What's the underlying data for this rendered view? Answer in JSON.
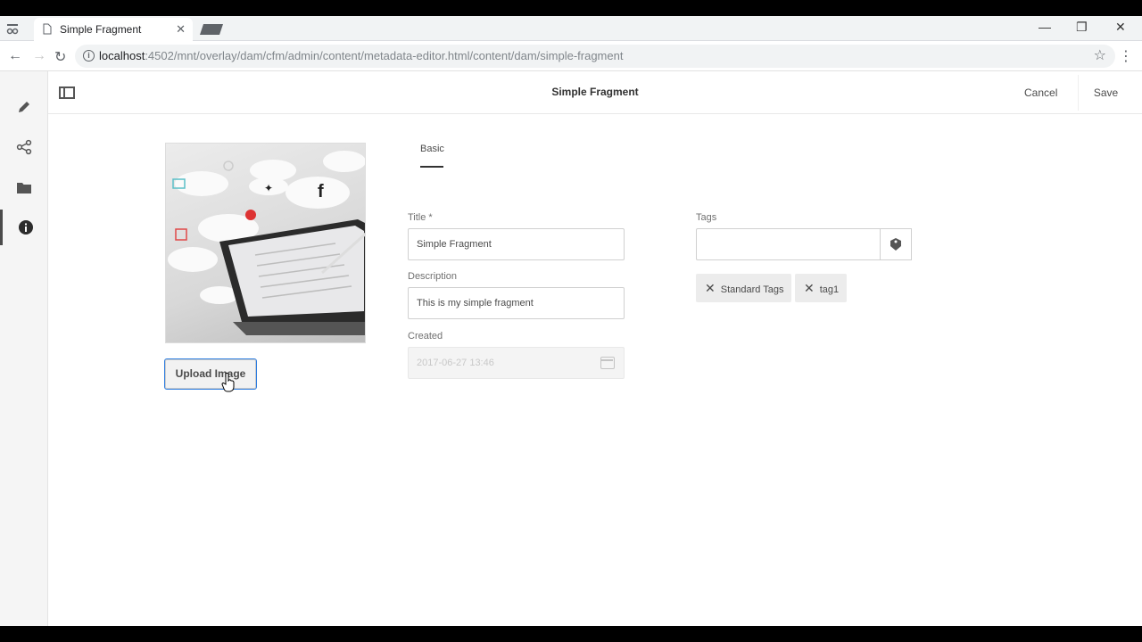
{
  "browser": {
    "tab_title": "Simple Fragment",
    "tab_close": "✕",
    "url_host": "localhost",
    "url_path": ":4502/mnt/overlay/dam/cfm/admin/content/metadata-editor.html/content/dam/simple-fragment",
    "window_controls": {
      "minimize": "—",
      "maximize": "❐",
      "close": "✕"
    }
  },
  "rail": {
    "items": [
      {
        "icon": "pencil-icon"
      },
      {
        "icon": "share-icon"
      },
      {
        "icon": "folder-icon"
      },
      {
        "icon": "info-icon",
        "active": true
      }
    ]
  },
  "header": {
    "title": "Simple Fragment",
    "cancel_label": "Cancel",
    "save_label": "Save"
  },
  "asset": {
    "upload_label": "Upload Image"
  },
  "tabs": [
    {
      "label": "Basic",
      "active": true
    }
  ],
  "form": {
    "title_label": "Title *",
    "title_value": "Simple Fragment",
    "description_label": "Description",
    "description_value": "This is my simple fragment",
    "created_label": "Created",
    "created_value": "2017-06-27 13:46",
    "tags_label": "Tags",
    "tags": [
      "Standard Tags",
      "tag1"
    ]
  },
  "colors": {
    "accent_focus": "#2d7de0",
    "text": "#4b4b4b"
  }
}
